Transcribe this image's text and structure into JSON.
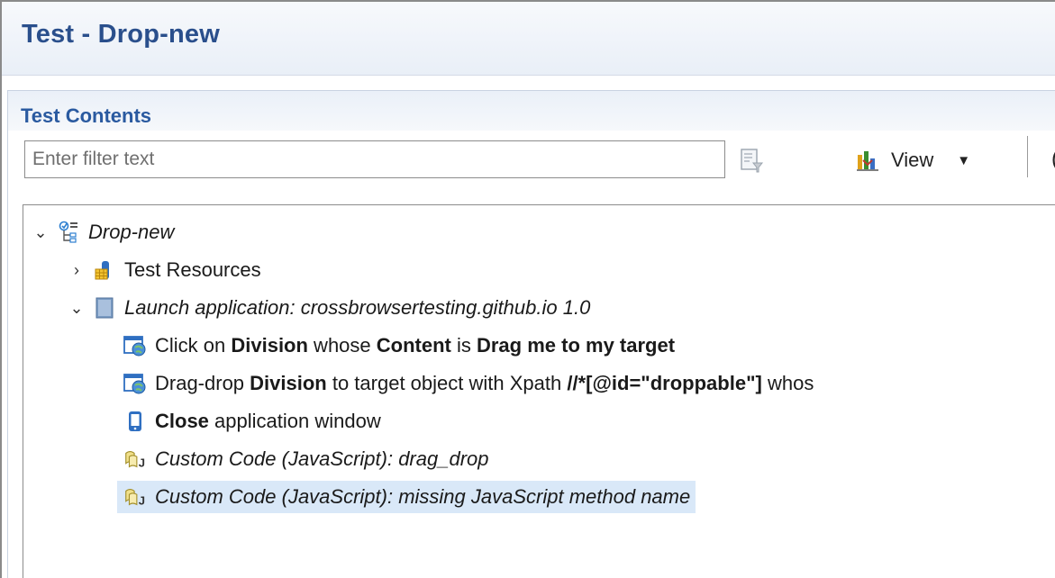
{
  "editor": {
    "title": "Test - Drop-new"
  },
  "section": {
    "title": "Test Contents"
  },
  "filter": {
    "placeholder": "Enter filter text",
    "value": ""
  },
  "toolbar": {
    "view_label": "View",
    "dropdown_glyph": "▼",
    "cut_glyph": "("
  },
  "tree": {
    "root": {
      "label": "Drop-new",
      "twisty": "⌄",
      "icon": "test-icon"
    },
    "resources": {
      "label": "Test Resources",
      "twisty": "›",
      "icon": "test-resources-icon"
    },
    "launch": {
      "label": "Launch application: crossbrowsertesting.github.io  1.0",
      "twisty": "⌄",
      "icon": "application-icon"
    },
    "steps": [
      {
        "icon": "web-action-icon",
        "parts": [
          {
            "t": "Click on ",
            "b": false
          },
          {
            "t": "Division",
            "b": true
          },
          {
            "t": " whose ",
            "b": false
          },
          {
            "t": "Content",
            "b": true
          },
          {
            "t": " is ",
            "b": false
          },
          {
            "t": "Drag me to my target",
            "b": true
          }
        ]
      },
      {
        "icon": "web-action-icon",
        "parts": [
          {
            "t": "Drag-drop ",
            "b": false
          },
          {
            "t": "Division",
            "b": true
          },
          {
            "t": " to target object with Xpath ",
            "b": false
          },
          {
            "t": "//*[@id=\"droppable\"]",
            "b": true
          },
          {
            "t": "  whos",
            "b": false
          }
        ]
      },
      {
        "icon": "close-window-icon",
        "parts": [
          {
            "t": "Close",
            "b": true
          },
          {
            "t": " application window",
            "b": false
          }
        ]
      }
    ],
    "custom_code": [
      {
        "label": "Custom Code (JavaScript): drag_drop",
        "icon": "javascript-icon",
        "selected": false
      },
      {
        "label": "Custom Code (JavaScript): missing JavaScript method name",
        "icon": "javascript-icon",
        "selected": true
      }
    ]
  }
}
